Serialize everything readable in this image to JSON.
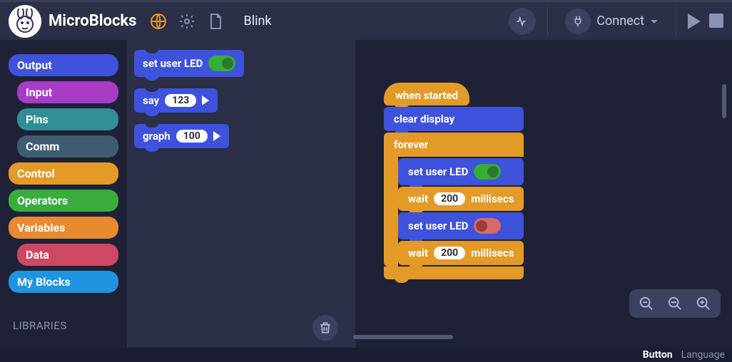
{
  "app": {
    "name": "MicroBlocks",
    "project": "Blink"
  },
  "toolbar": {
    "connect": "Connect",
    "signal_icon": "signal-icon",
    "plug_icon": "plug-icon"
  },
  "sidebar": {
    "categories": [
      {
        "label": "Output",
        "cls": "output"
      },
      {
        "label": "Input",
        "cls": "input"
      },
      {
        "label": "Pins",
        "cls": "pins"
      },
      {
        "label": "Comm",
        "cls": "comm"
      },
      {
        "label": "Control",
        "cls": "control"
      },
      {
        "label": "Operators",
        "cls": "operators"
      },
      {
        "label": "Variables",
        "cls": "variables"
      },
      {
        "label": "Data",
        "cls": "data"
      },
      {
        "label": "My Blocks",
        "cls": "myblocks"
      }
    ],
    "libraries": "LIBRARIES"
  },
  "palette": {
    "set_user_led": "set user LED",
    "say": "say",
    "say_val": "123",
    "graph": "graph",
    "graph_val": "100"
  },
  "script": {
    "hat": "when started",
    "clear_display": "clear display",
    "forever": "forever",
    "set_user_led": "set user LED",
    "wait": "wait",
    "wait_val1": "200",
    "wait_val2": "200",
    "millisecs": "millisecs"
  },
  "footer": {
    "button": "Button",
    "language": "Language"
  }
}
